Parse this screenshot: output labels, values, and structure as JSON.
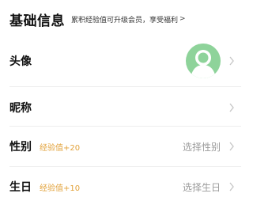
{
  "header": {
    "title": "基础信息",
    "promo_text": "累积经验值可升级会员，享受福利",
    "promo_chevron": ">"
  },
  "rows": [
    {
      "label": "头像",
      "xp": "",
      "value": "",
      "has_avatar": true
    },
    {
      "label": "昵称",
      "xp": "",
      "value": ""
    },
    {
      "label": "性别",
      "xp": "经验值+20",
      "value": "选择性别"
    },
    {
      "label": "生日",
      "xp": "经验值+10",
      "value": "选择生日"
    }
  ],
  "colors": {
    "xp_accent": "#e2a23a",
    "avatar_bg": "#8ed39a",
    "muted_text": "#9b9b9b"
  },
  "icons": {
    "row_chevron": "chevron-right-icon",
    "avatar_placeholder": "user-silhouette-icon"
  }
}
